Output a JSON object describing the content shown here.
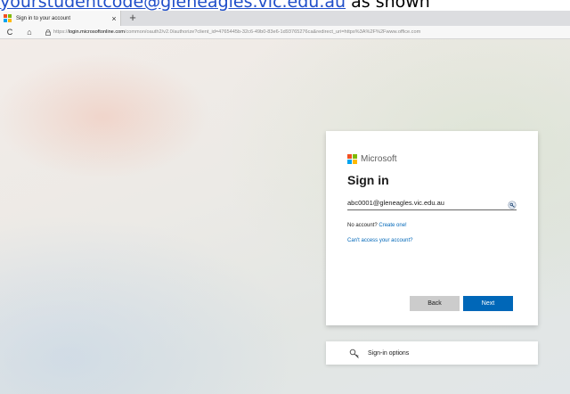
{
  "caption": {
    "link_text": "yourstudentcode@gleneagles.vic.edu.au",
    "rest_text": " as shown"
  },
  "browser": {
    "tab_title": "Sign in to your account",
    "tab_close": "×",
    "new_tab": "+",
    "back_icon": "C",
    "home_icon": "⌂",
    "url_prefix": "https://",
    "url_host": "login.microsoftonline.com",
    "url_rest": "/common/oauth2/v2.0/authorize?client_id=4765445b-32c6-49b0-83e6-1d93765276ca&redirect_uri=https%3A%2F%2Fwww.office.com"
  },
  "signin": {
    "brand": "Microsoft",
    "title": "Sign in",
    "email_value": "abc0001@gleneagles.vic.edu.au",
    "no_account_text": "No account?",
    "create_link": "Create one!",
    "cant_access": "Can't access your account?",
    "back_label": "Back",
    "next_label": "Next"
  },
  "options": {
    "label": "Sign-in options"
  },
  "colors": {
    "ms_red": "#f25022",
    "ms_green": "#7fba00",
    "ms_blue": "#00a4ef",
    "ms_yellow": "#ffb900",
    "primary": "#0067b8"
  }
}
